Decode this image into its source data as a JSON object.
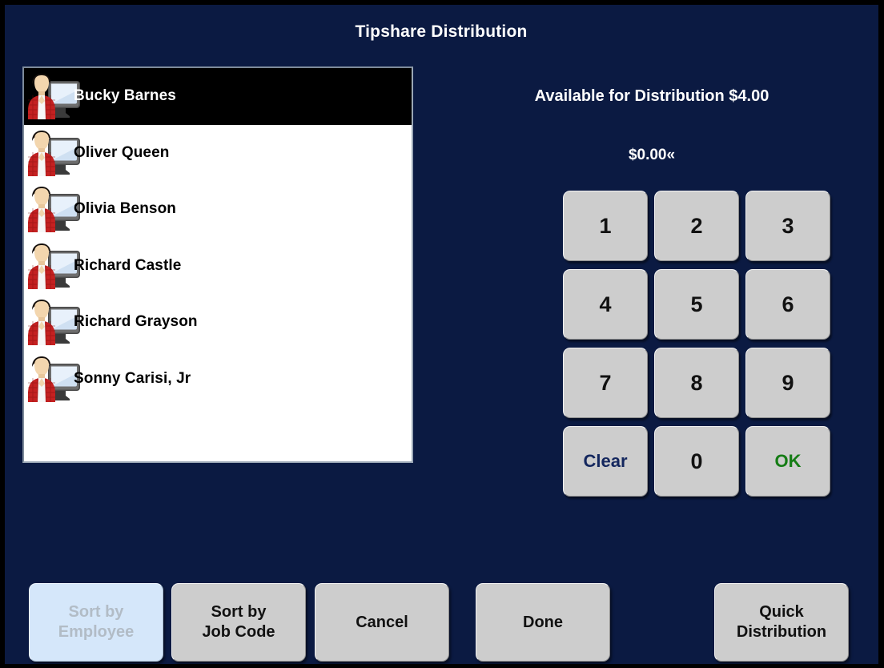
{
  "window": {
    "title": "Tipshare Distribution",
    "background_color": "#0b1a42",
    "border_color": "#000000"
  },
  "employee_list": {
    "selected_index": 0,
    "row_icon": "employee-workstation-icon",
    "rows": [
      {
        "name": "Bucky Barnes",
        "selected": true
      },
      {
        "name": "Oliver Queen",
        "selected": false
      },
      {
        "name": "Olivia Benson",
        "selected": false
      },
      {
        "name": "Richard Castle",
        "selected": false
      },
      {
        "name": "Richard Grayson",
        "selected": false
      },
      {
        "name": "Sonny Carisi, Jr",
        "selected": false
      }
    ]
  },
  "distribution": {
    "available_label": "Available for Distribution $4.00",
    "available_amount": "$4.00",
    "entry_value": "$0.00«",
    "entry_amount": "$0.00",
    "cursor_glyph": "«"
  },
  "keypad": {
    "keys": [
      {
        "label": "1",
        "name": "key-1",
        "style": "digit"
      },
      {
        "label": "2",
        "name": "key-2",
        "style": "digit"
      },
      {
        "label": "3",
        "name": "key-3",
        "style": "digit"
      },
      {
        "label": "4",
        "name": "key-4",
        "style": "digit"
      },
      {
        "label": "5",
        "name": "key-5",
        "style": "digit"
      },
      {
        "label": "6",
        "name": "key-6",
        "style": "digit"
      },
      {
        "label": "7",
        "name": "key-7",
        "style": "digit"
      },
      {
        "label": "8",
        "name": "key-8",
        "style": "digit"
      },
      {
        "label": "9",
        "name": "key-9",
        "style": "digit"
      },
      {
        "label": "Clear",
        "name": "key-clear",
        "style": "clear"
      },
      {
        "label": "0",
        "name": "key-0",
        "style": "digit"
      },
      {
        "label": "OK",
        "name": "key-ok",
        "style": "ok"
      }
    ],
    "clear_text_color": "#14275e",
    "ok_text_color": "#157c15",
    "key_face_color": "#cdcdcd"
  },
  "footer": {
    "sort_by_employee": "Sort by\nEmployee",
    "sort_by_employee_enabled": false,
    "sort_by_job_code": "Sort by\nJob Code",
    "cancel": "Cancel",
    "done": "Done",
    "quick_distribution": "Quick\nDistribution",
    "disabled_bg_color": "#d5e7fa",
    "disabled_text_color": "#b2bcc6"
  }
}
